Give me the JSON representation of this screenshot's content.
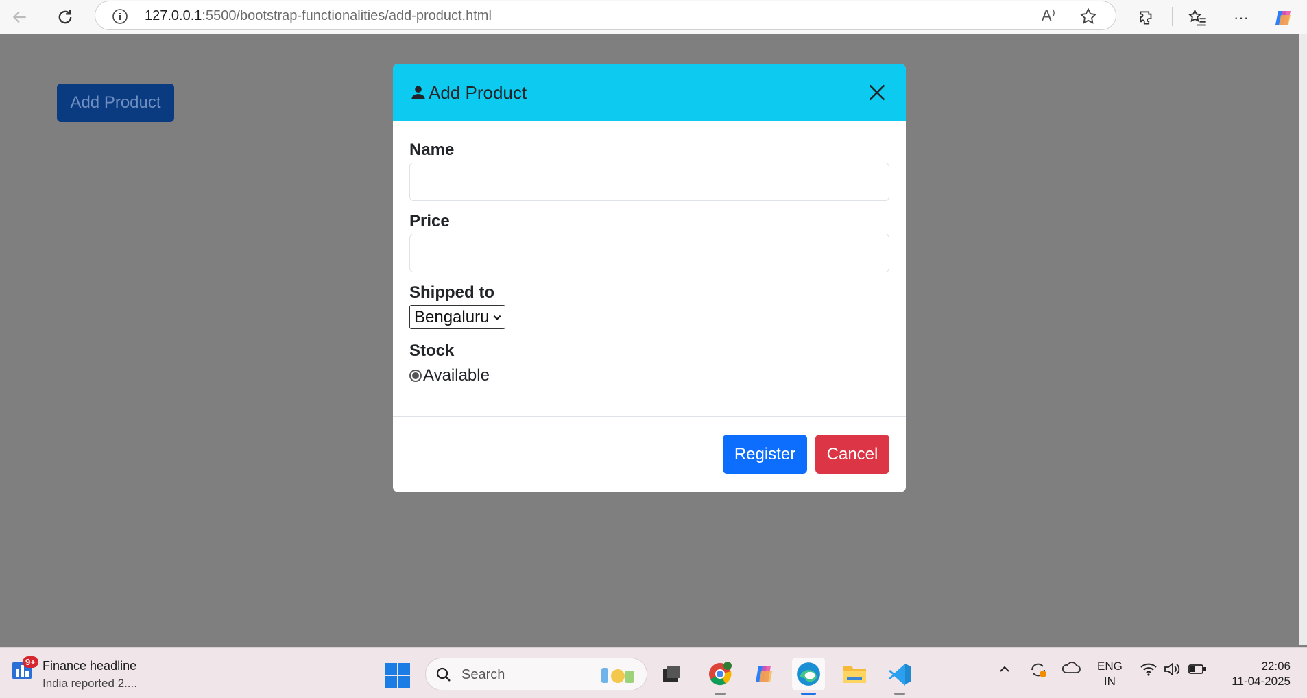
{
  "browser": {
    "url_host": "127.0.0.1",
    "url_path": ":5500/bootstrap-functionalities/add-product.html"
  },
  "page": {
    "add_product_button": "Add Product"
  },
  "modal": {
    "title": "Add Product",
    "header_color": "#0dcaf0",
    "fields": {
      "name_label": "Name",
      "name_value": "",
      "price_label": "Price",
      "price_value": "",
      "shipped_label": "Shipped to",
      "shipped_value": "Bengaluru",
      "stock_label": "Stock",
      "stock_option": "Available",
      "stock_selected": true
    },
    "footer": {
      "register_label": "Register",
      "cancel_label": "Cancel"
    }
  },
  "taskbar": {
    "widget_badge": "9+",
    "news_title": "Finance headline",
    "news_sub": "India reported 2....",
    "search_placeholder": "Search",
    "lang_line1": "ENG",
    "lang_line2": "IN",
    "time": "22:06",
    "date": "11-04-2025"
  }
}
